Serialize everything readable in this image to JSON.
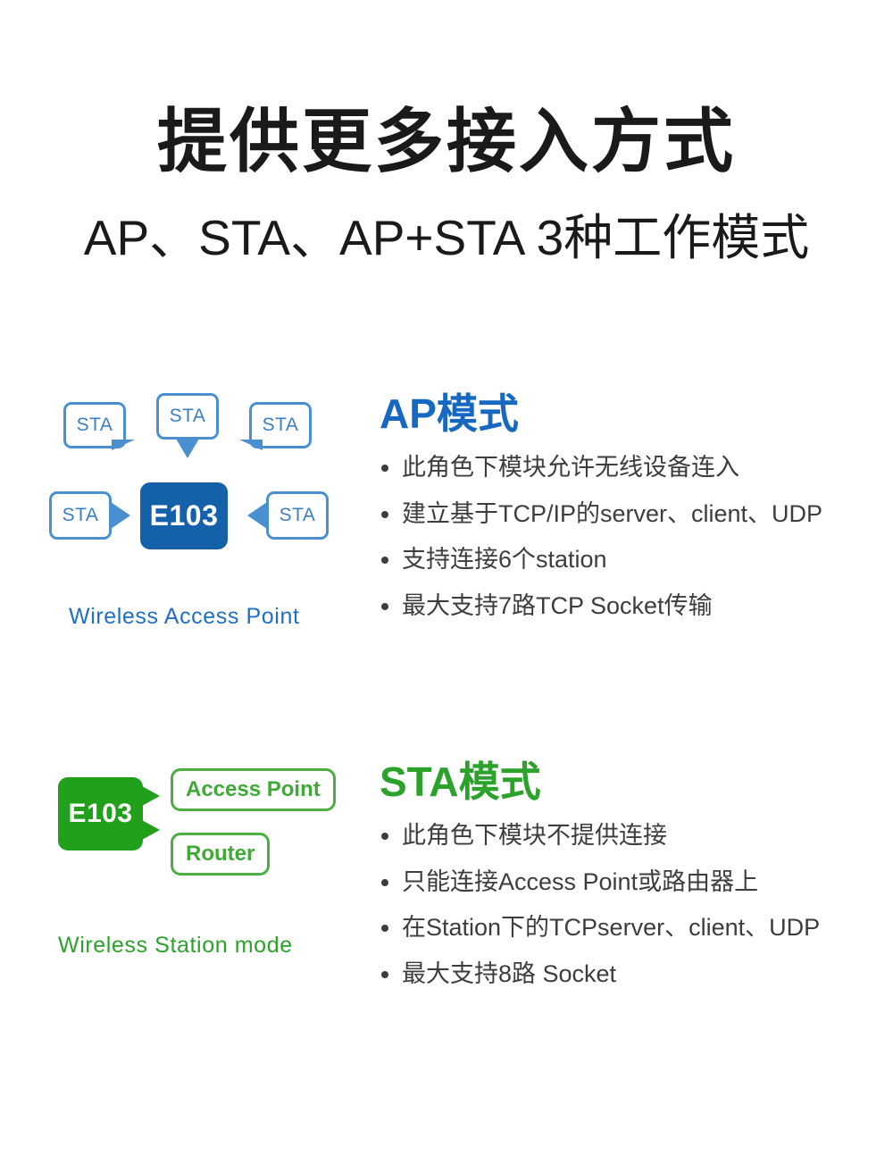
{
  "header": {
    "title": "提供更多接入方式",
    "subtitle": "AP、STA、AP+STA 3种工作模式"
  },
  "colors": {
    "blue_heading": "#1668c0",
    "blue_box": "#1461aa",
    "blue_bubble": "#4a90d0",
    "blue_caption": "#1f6fc4",
    "green_heading": "#2ba22a",
    "green_box": "#21a01b",
    "green_bubble": "#4caf43",
    "green_caption": "#2ba22a",
    "body_text": "#3d3d3d",
    "title_text": "#1a1a1a"
  },
  "ap_mode": {
    "heading": "AP模式",
    "diagram": {
      "center_label": "E103",
      "clients": [
        "STA",
        "STA",
        "STA",
        "STA",
        "STA"
      ],
      "caption": "Wireless Access Point"
    },
    "bullets": [
      "此角色下模块允许无线设备连入",
      "建立基于TCP/IP的server、client、UDP",
      "支持连接6个station",
      "最大支持7路TCP Socket传输"
    ]
  },
  "sta_mode": {
    "heading": "STA模式",
    "diagram": {
      "center_label": "E103",
      "targets": [
        "Access Point",
        "Router"
      ],
      "caption": "Wireless Station mode"
    },
    "bullets": [
      "此角色下模块不提供连接",
      "只能连接Access Point或路由器上",
      "在Station下的TCPserver、client、UDP",
      "最大支持8路 Socket"
    ]
  }
}
